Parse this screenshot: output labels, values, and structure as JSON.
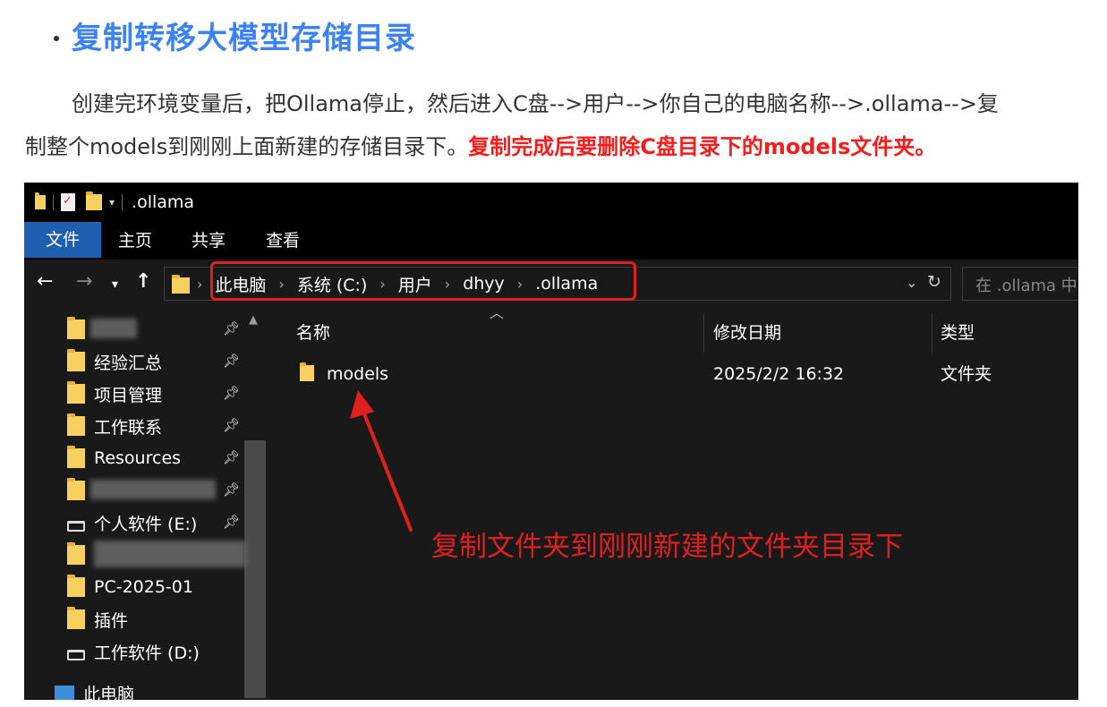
{
  "article": {
    "heading": "复制转移大模型存储目录",
    "para_line1": "创建完环境变量后，把Ollama停止，然后进入C盘-->用户-->你自己的电脑名称-->.ollama-->复",
    "para_line2_normal": "制整个models到刚刚上面新建的存储目录下。",
    "para_line2_warn": "复制完成后要删除C盘目录下的models文件夹。"
  },
  "explorer": {
    "window_title": ".ollama",
    "ribbon_tabs": [
      "文件",
      "主页",
      "共享",
      "查看"
    ],
    "breadcrumbs": [
      "此电脑",
      "系统 (C:)",
      "用户",
      "dhyy",
      ".ollama"
    ],
    "search_placeholder": "在 .ollama 中",
    "sidebar": {
      "items": [
        {
          "label": "经验汇总",
          "type": "folder",
          "pinned": true
        },
        {
          "label": "项目管理",
          "type": "folder",
          "pinned": true
        },
        {
          "label": "工作联系",
          "type": "folder",
          "pinned": true
        },
        {
          "label": "Resources",
          "type": "folder",
          "pinned": true
        },
        {
          "label": "个人软件 (E:)",
          "type": "drive",
          "pinned": true
        },
        {
          "label": "PC-2025-01",
          "type": "folder",
          "pinned": false
        },
        {
          "label": "插件",
          "type": "folder",
          "pinned": false
        },
        {
          "label": "工作软件 (D:)",
          "type": "drive",
          "pinned": false
        },
        {
          "label": "此电脑",
          "type": "pc",
          "pinned": false
        }
      ]
    },
    "columns": {
      "name": "名称",
      "modified": "修改日期",
      "type": "类型"
    },
    "files": [
      {
        "name": "models",
        "modified": "2025/2/2 16:32",
        "type": "文件夹"
      }
    ],
    "annotation": "复制文件夹到刚刚新建的文件夹目录下"
  },
  "colors": {
    "heading_blue": "#3b82f6",
    "warning_red": "#f51c1c",
    "annotation_red": "#e02020",
    "explorer_bg": "#191919",
    "ribbon_active": "#1f5fb2",
    "folder_yellow": "#f7d05f"
  },
  "icons": [
    "folder-icon",
    "document-icon",
    "pin-icon",
    "drive-icon",
    "pc-icon",
    "back-arrow-icon",
    "forward-arrow-icon",
    "up-arrow-icon",
    "refresh-icon",
    "chevron-down-icon",
    "chevron-right-icon"
  ]
}
